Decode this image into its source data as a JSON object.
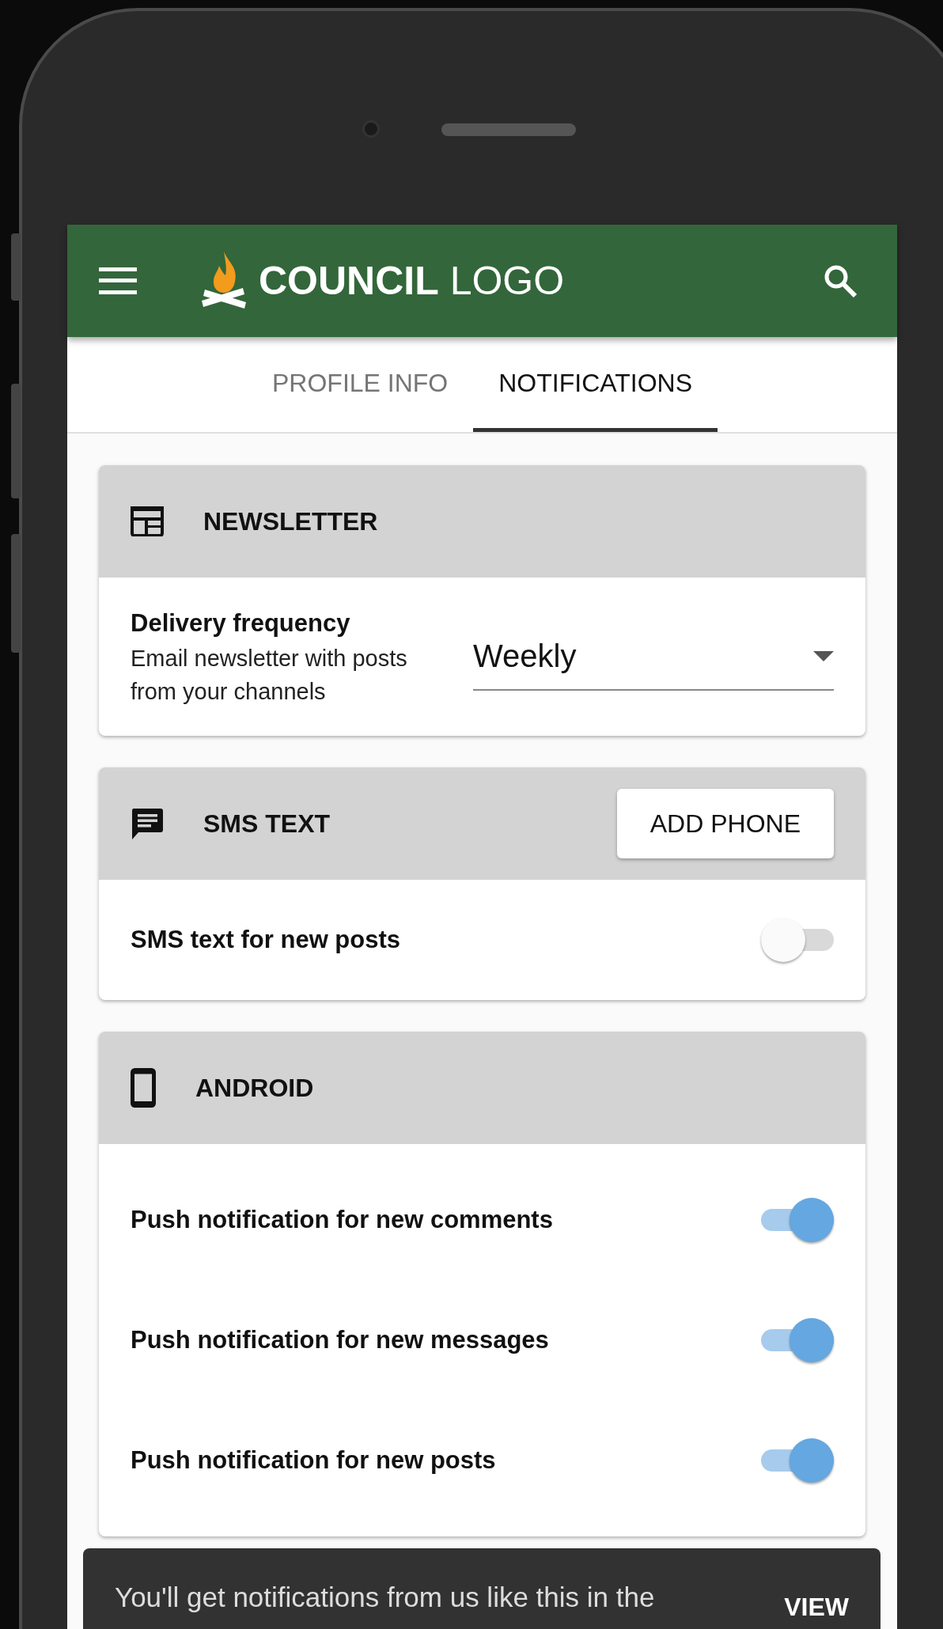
{
  "header": {
    "logo_bold": "COUNCIL",
    "logo_light": "LOGO"
  },
  "tabs": [
    {
      "label": "PROFILE INFO",
      "selected": false
    },
    {
      "label": "NOTIFICATIONS",
      "selected": true
    }
  ],
  "sections": [
    {
      "title": "NEWSLETTER",
      "rows": [
        {
          "kind": "select",
          "label": "Delivery frequency",
          "description": "Email newsletter with posts from your channels",
          "value": "Weekly"
        }
      ]
    },
    {
      "title": "SMS TEXT",
      "button": "ADD PHONE",
      "rows": [
        {
          "kind": "toggle",
          "label": "SMS text for new posts",
          "on": false
        }
      ]
    },
    {
      "title": "ANDROID",
      "rows": [
        {
          "kind": "toggle",
          "label": "Push notification for new comments",
          "on": true
        },
        {
          "kind": "toggle",
          "label": "Push notification for new messages",
          "on": true
        },
        {
          "kind": "toggle",
          "label": "Push notification for new posts",
          "on": true
        }
      ]
    }
  ],
  "snackbar": {
    "message": "You'll get notifications from us like this in the",
    "action": "VIEW"
  }
}
